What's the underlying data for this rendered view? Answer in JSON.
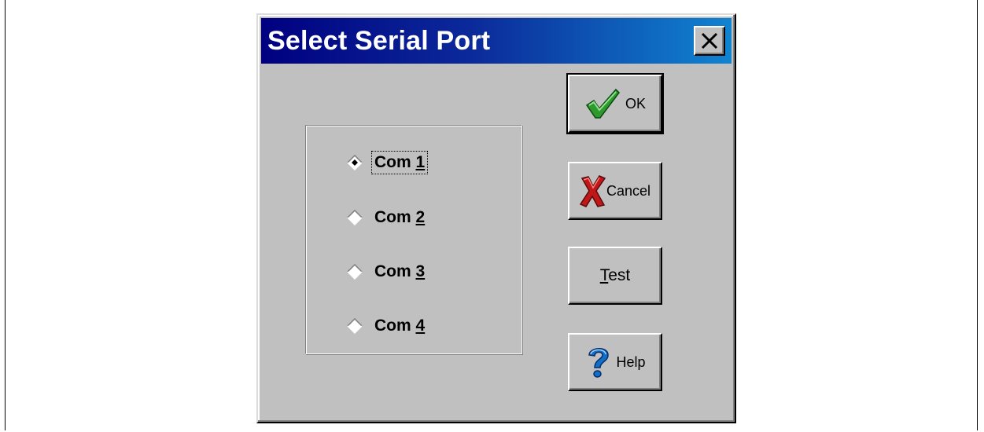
{
  "dialog": {
    "title": "Select Serial Port",
    "close_icon": "close-x-icon"
  },
  "ports": [
    {
      "prefix": "Com ",
      "accel": "1",
      "selected": true,
      "focused": true
    },
    {
      "prefix": "Com ",
      "accel": "2",
      "selected": false,
      "focused": false
    },
    {
      "prefix": "Com ",
      "accel": "3",
      "selected": false,
      "focused": false
    },
    {
      "prefix": "Com ",
      "accel": "4",
      "selected": false,
      "focused": false
    }
  ],
  "buttons": {
    "ok": {
      "label": "OK",
      "icon": "checkmark-icon",
      "default": true
    },
    "cancel": {
      "label": "Cancel",
      "icon": "red-x-icon"
    },
    "test": {
      "accel": "T",
      "rest": "est"
    },
    "help": {
      "label": "Help",
      "icon": "question-mark-icon"
    }
  },
  "colors": {
    "title_start": "#000080",
    "title_end": "#1084d0",
    "face": "#c0c0c0",
    "check_green": "#2e9a2e",
    "cancel_red": "#c01818",
    "help_blue": "#1070c8"
  }
}
